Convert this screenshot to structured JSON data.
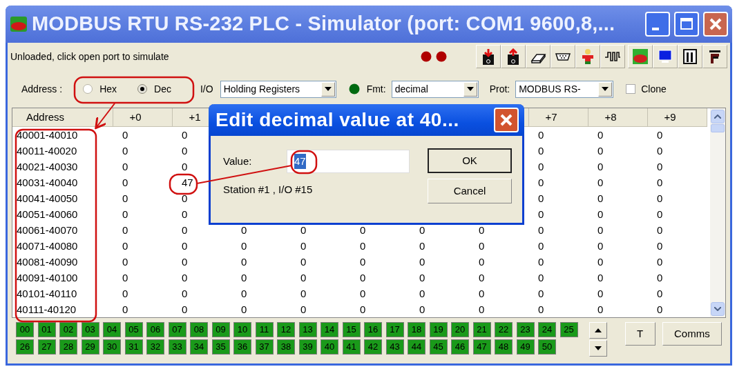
{
  "window": {
    "title": "MODBUS RTU RS-232 PLC - Simulator (port: COM1 9600,8,..."
  },
  "status_text": "Unloaded, click open port to simulate",
  "address_mode": {
    "label": "Address :",
    "options": [
      {
        "label": "Hex",
        "selected": false
      },
      {
        "label": "Dec",
        "selected": true
      }
    ]
  },
  "io": {
    "label": "I/O",
    "value": "Holding Registers"
  },
  "format": {
    "label": "Fmt:",
    "value": "decimal"
  },
  "protocol": {
    "label": "Prot:",
    "value": "MODBUS RS-"
  },
  "clone": {
    "label": "Clone",
    "checked": false
  },
  "table": {
    "columns": [
      "Address",
      "+0",
      "+1",
      "",
      "",
      "",
      "",
      "",
      "+7",
      "+8",
      "+9"
    ],
    "rows": [
      [
        "40001-40010",
        "0",
        "0",
        "",
        "",
        "",
        "",
        "",
        "0",
        "0",
        "0"
      ],
      [
        "40011-40020",
        "0",
        "0",
        "",
        "",
        "",
        "",
        "",
        "0",
        "0",
        "0"
      ],
      [
        "40021-40030",
        "0",
        "0",
        "",
        "",
        "",
        "",
        "",
        "0",
        "0",
        "0"
      ],
      [
        "40031-40040",
        "0",
        "47",
        "",
        "",
        "",
        "",
        "",
        "0",
        "0",
        "0"
      ],
      [
        "40041-40050",
        "0",
        "0",
        "",
        "",
        "",
        "",
        "",
        "0",
        "0",
        "0"
      ],
      [
        "40051-40060",
        "0",
        "0",
        "",
        "",
        "",
        "",
        "",
        "0",
        "0",
        "0"
      ],
      [
        "40061-40070",
        "0",
        "0",
        "0",
        "0",
        "0",
        "0",
        "0",
        "0",
        "0",
        "0"
      ],
      [
        "40071-40080",
        "0",
        "0",
        "0",
        "0",
        "0",
        "0",
        "0",
        "0",
        "0",
        "0"
      ],
      [
        "40081-40090",
        "0",
        "0",
        "0",
        "0",
        "0",
        "0",
        "0",
        "0",
        "0",
        "0"
      ],
      [
        "40091-40100",
        "0",
        "0",
        "0",
        "0",
        "0",
        "0",
        "0",
        "0",
        "0",
        "0"
      ],
      [
        "40101-40110",
        "0",
        "0",
        "0",
        "0",
        "0",
        "0",
        "0",
        "0",
        "0",
        "0"
      ],
      [
        "40111-40120",
        "0",
        "0",
        "0",
        "0",
        "0",
        "0",
        "0",
        "0",
        "0",
        "0"
      ]
    ]
  },
  "stations": [
    [
      "00",
      "01",
      "02",
      "03",
      "04",
      "05",
      "06",
      "07",
      "08",
      "09",
      "10",
      "11",
      "12",
      "13",
      "14",
      "15",
      "16",
      "17",
      "18",
      "19",
      "20",
      "21",
      "22",
      "23",
      "24",
      "25"
    ],
    [
      "26",
      "27",
      "28",
      "29",
      "30",
      "31",
      "32",
      "33",
      "34",
      "35",
      "36",
      "37",
      "38",
      "39",
      "40",
      "41",
      "42",
      "43",
      "44",
      "45",
      "46",
      "47",
      "48",
      "49",
      "50"
    ]
  ],
  "buttons": [
    "T",
    "Comms"
  ],
  "dialog": {
    "title": "Edit decimal value at 40...",
    "value_label": "Value:",
    "value": "47",
    "info": "Station #1 , I/O #15",
    "buttons": [
      "OK",
      "Cancel"
    ]
  }
}
